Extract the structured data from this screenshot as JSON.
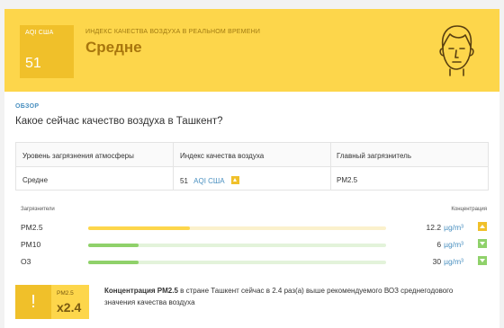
{
  "hero": {
    "aqi_label": "AQI США",
    "aqi_value": "51",
    "realtime_label": "ИНДЕКС КАЧЕСТВА ВОЗДУХА В РЕАЛЬНОМ ВРЕМЕНИ",
    "status": "Средне",
    "background_color": "#fdd64b",
    "avatar_icon": "face-icon"
  },
  "overview": {
    "section_label": "ОБЗОР",
    "question": "Какое сейчас качество воздуха в Ташкент?"
  },
  "table": {
    "headers": [
      "Уровень загрязнения атмосферы",
      "Индекс качества воздуха",
      "Главный загрязнитель"
    ],
    "level": "Средне",
    "aqi_value": "51",
    "aqi_unit": "AQI США",
    "main_pollutant": "PM2.5"
  },
  "pollutants": {
    "label_left": "Загрязнители",
    "label_right": "Концентрация",
    "rows": [
      {
        "name": "PM2.5",
        "value": "12.2",
        "unit": "µg/m³",
        "fill_fraction": 0.34,
        "color": "#fdd64b",
        "track_color": "#fbf1cc",
        "trend": "up",
        "indicator_color": "#f0c02a"
      },
      {
        "name": "PM10",
        "value": "6",
        "unit": "µg/m³",
        "fill_fraction": 0.17,
        "color": "#8fd16a",
        "track_color": "#e3f3da",
        "trend": "down",
        "indicator_color": "#8fd16a"
      },
      {
        "name": "O3",
        "value": "30",
        "unit": "µg/m³",
        "fill_fraction": 0.17,
        "color": "#8fd16a",
        "track_color": "#e3f3da",
        "trend": "down",
        "indicator_color": "#8fd16a"
      }
    ]
  },
  "recommendation": {
    "pollutant": "PM2.5",
    "multiplier": "x2.4",
    "bold_text": "Концентрация PM2.5",
    "text": " в стране Ташкент сейчас в 2.4 раз(а) выше рекомендуемого ВОЗ среднегодового значения качества воздуха"
  }
}
